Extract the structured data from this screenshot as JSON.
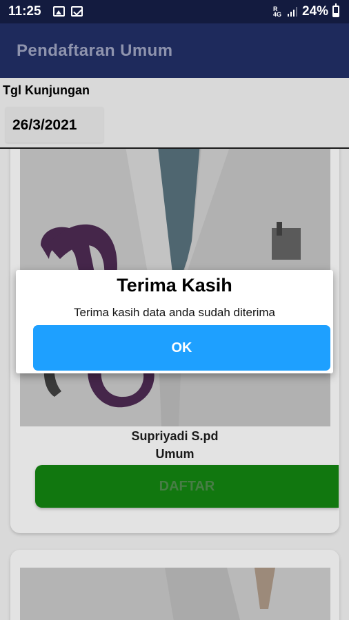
{
  "status_bar": {
    "time": "11:25",
    "battery_percent": "24%",
    "network_type_top": "R",
    "network_type_bottom": "4G",
    "icons": [
      "gallery-icon",
      "mail-icon",
      "data-icon",
      "signal-icon",
      "battery-icon"
    ]
  },
  "app_bar": {
    "title": "Pendaftaran Umum"
  },
  "visit": {
    "label": "Tgl Kunjungan",
    "date": "26/3/2021"
  },
  "doctors": [
    {
      "name": "Supriyadi S.pd",
      "poly": "Umum",
      "button_label": "DAFTAR"
    }
  ],
  "dialog": {
    "title": "Terima Kasih",
    "message": "Terima kasih data anda sudah diterima",
    "ok_label": "OK"
  },
  "colors": {
    "status_bar": "#131b3f",
    "app_bar": "#1e2a5c",
    "daftar_button": "#11770f",
    "ok_button": "#1ea0ff",
    "dialog_background": "#ffffff"
  }
}
